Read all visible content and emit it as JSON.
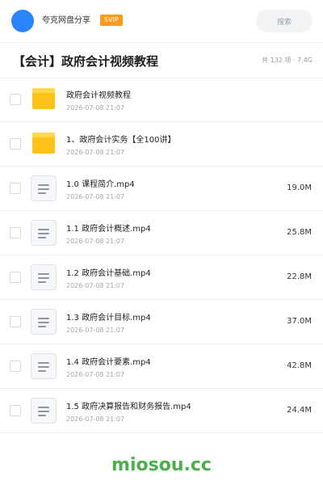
{
  "header": {
    "share_name": "夸克网盘分享",
    "badge": "SVIP",
    "search_placeholder": "搜索"
  },
  "folder": {
    "title": "【会计】政府会计视频教程",
    "meta": "共 132 项 · 7.4G"
  },
  "items": [
    {
      "type": "folder",
      "name": "政府会计视频教程",
      "date": "2026-07-08 21:07",
      "size": ""
    },
    {
      "type": "folder",
      "name": "1、政府会计实务【全100讲】",
      "date": "2026-07-08 21:07",
      "size": ""
    },
    {
      "type": "file",
      "name": "1.0 课程简介.mp4",
      "date": "2026-07-08 21:07",
      "size": "19.0M"
    },
    {
      "type": "file",
      "name": "1.1 政府会计概述.mp4",
      "date": "2026-07-08 21:07",
      "size": "25.8M"
    },
    {
      "type": "file",
      "name": "1.2 政府会计基础.mp4",
      "date": "2026-07-08 21:07",
      "size": "22.8M"
    },
    {
      "type": "file",
      "name": "1.3 政府会计目标.mp4",
      "date": "2026-07-08 21:07",
      "size": "37.0M"
    },
    {
      "type": "file",
      "name": "1.4 政府会计要素.mp4",
      "date": "2026-07-08 21:07",
      "size": "42.8M"
    },
    {
      "type": "file",
      "name": "1.5 政府决算报告和财务报告.mp4",
      "date": "2026-07-08 21:07",
      "size": "24.4M"
    }
  ],
  "watermark": "miosou.cc",
  "colors": {
    "avatar": "#2a84ff",
    "badge": "#ff9a1f",
    "folder_icon": "#ffc21a",
    "watermark": "#4cae4c"
  },
  "icons": {
    "folder": "folder-icon",
    "file": "video-file-icon"
  }
}
